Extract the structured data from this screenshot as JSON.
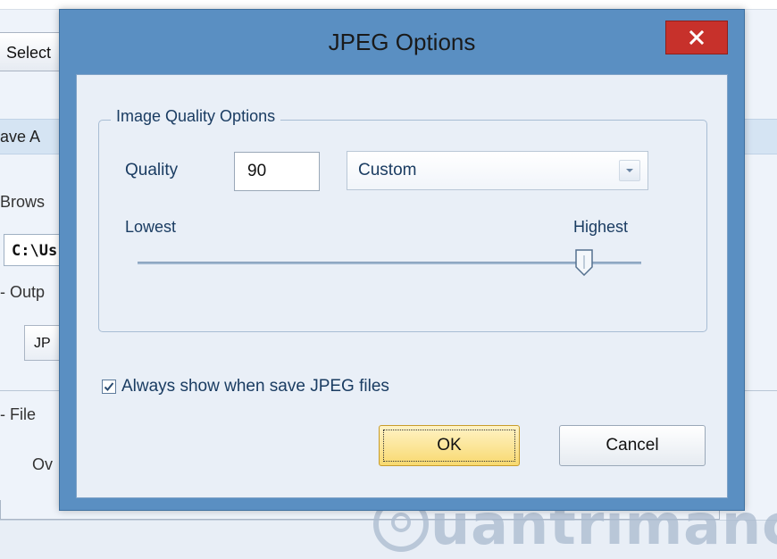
{
  "background": {
    "select_button": "Select",
    "save_label": "ave A",
    "browse_label": "Brows",
    "path_value": "C:\\Us",
    "output_label": "- Outp",
    "format_value": "JP",
    "file_label": "- File",
    "overwrite_label": "Ov",
    "watermark": "uantrimanc"
  },
  "dialog": {
    "title": "JPEG Options",
    "close_icon": "close-icon",
    "group": {
      "legend": "Image Quality Options",
      "quality_label": "Quality",
      "quality_value": "90",
      "preset_value": "Custom",
      "lowest_label": "Lowest",
      "highest_label": "Highest",
      "slider_value": 90
    },
    "checkbox": {
      "label": "Always show when save JPEG files",
      "checked": true
    },
    "buttons": {
      "ok": "OK",
      "cancel": "Cancel"
    }
  },
  "colors": {
    "title_bar": "#5a8fc2",
    "close_button": "#c7312b",
    "ok_button": "#f8d96f",
    "client_bg": "#e9eff7"
  }
}
